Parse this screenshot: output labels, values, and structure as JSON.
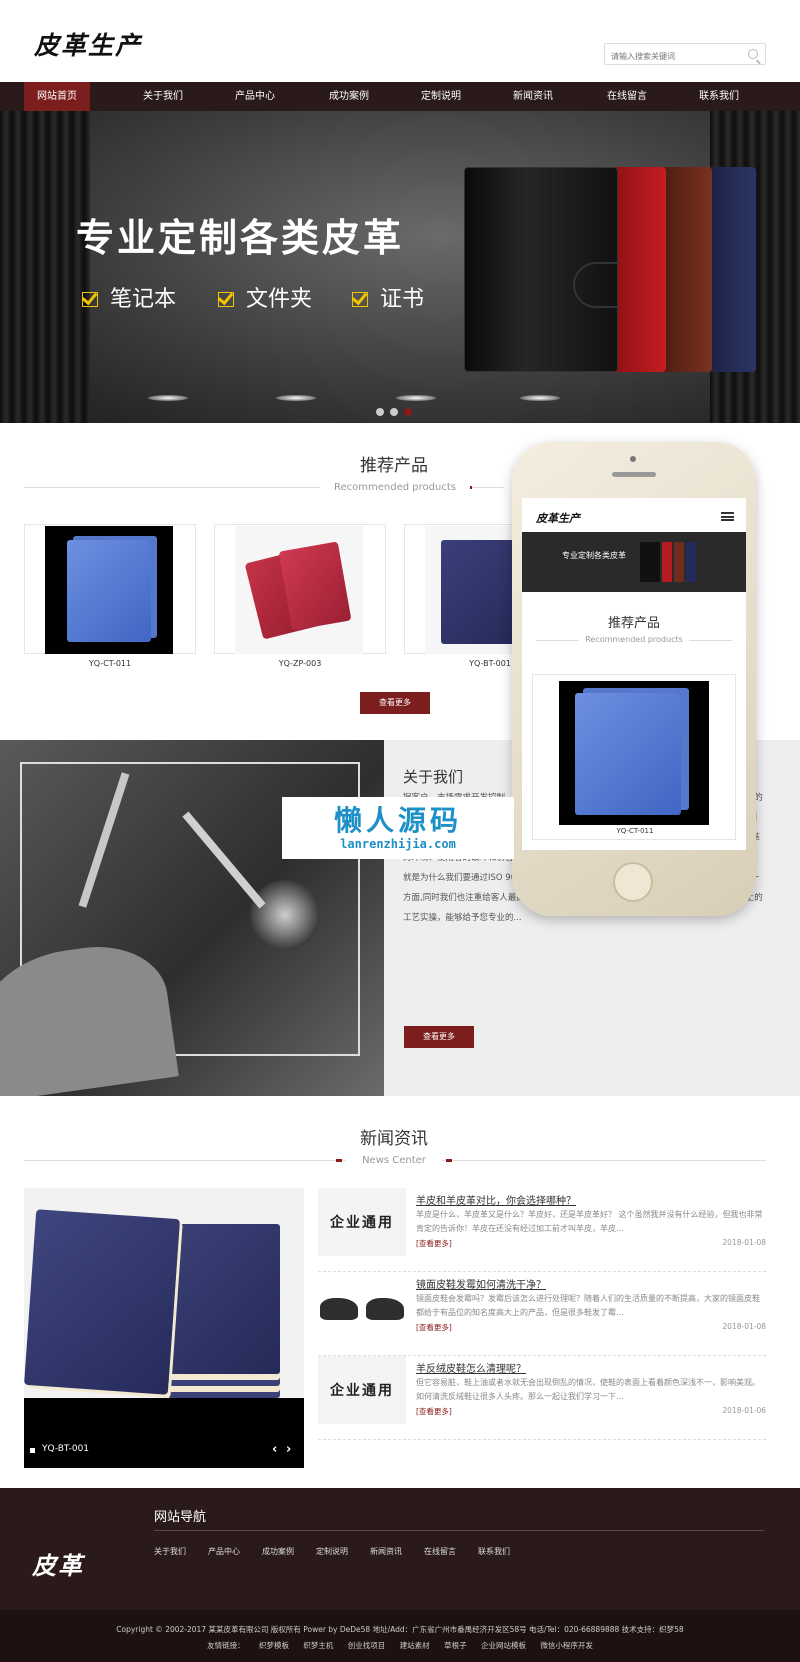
{
  "header": {
    "logo": "皮革生产",
    "search_placeholder": "请输入搜索关键词"
  },
  "nav": {
    "items": [
      "网站首页",
      "关于我们",
      "产品中心",
      "成功案例",
      "定制说明",
      "新闻资讯",
      "在线留言",
      "联系我们"
    ],
    "active_index": 0
  },
  "banner": {
    "title": "专业定制各类皮革",
    "features": [
      "笔记本",
      "文件夹",
      "证书"
    ],
    "slide_count": 3,
    "active_slide": 2
  },
  "products": {
    "title": "推荐产品",
    "subtitle": "Recommended products",
    "items": [
      {
        "label": "YQ-CT-011"
      },
      {
        "label": "YQ-ZP-003"
      },
      {
        "label": "YQ-BT-001"
      }
    ],
    "more_button": "查看更多"
  },
  "about": {
    "title": "关于我们",
    "text": "据客户、市场需求开发控制，能以确保我们的皮革能够满足…标,在过去的几年里我们有很多…的活动对环境所成的影响,和我们坚持严格管理制度，旨在减少任何潜在的破坏环境行为,定期检测和监控。所以我们所生产的产品均可按要求达到欧美最新环保、物性标准，尽最大努力减少皮革对环境、使用者的破坏和伤害。质量与服务 维护质量对我们非常重要,这是我们生存的根本！这就是为什么我们要通过ISO 9001管理标准的原因。然而,我们非常意识到产品质量的只是其中一方面,同时我们也注重给客人最高水平的客户服务。我们的销售团队均在工厂基层做好两年以上的工艺实操，能够给予您专业的...",
    "more_button": "查看更多"
  },
  "phone": {
    "logo": "皮革生产",
    "banner_text": "专业定制各类皮革",
    "section_title": "推荐产品",
    "section_subtitle": "Recommended products",
    "product_label": "YQ-CT-011"
  },
  "watermark": {
    "title": "懒人源码",
    "url": "lanrenzhijia.com"
  },
  "news": {
    "title": "新闻资讯",
    "subtitle": "News Center",
    "featured_caption": "YQ-BT-001",
    "items": [
      {
        "title": "羊皮和羊皮革对比，你会选择哪种？",
        "desc": "羊皮是什么，羊皮革又是什么？羊皮好，还是羊皮革好？ 这个虽然我并没有什么经验，但我也非常肯定的告诉你！羊皮在还没有经过加工前才叫羊皮，羊皮...",
        "more": "[查看更多]",
        "date": "2018-01-08",
        "thumb_text": "企业通用"
      },
      {
        "title": "镜面皮鞋发霉如何清洗干净？",
        "desc": "镜面皮鞋会发霉吗？发霉后该怎么进行处理呢？随着人们的生活质量的不断提高，大家的镜面皮鞋都给于有品位的知名度高大上的产品，但是很多鞋发了霉...",
        "more": "[查看更多]",
        "date": "2018-01-08",
        "thumb_text": ""
      },
      {
        "title": "羊反绒皮鞋怎么清理呢？",
        "desc": "但它容易脏，鞋上油或者水就无会出现倒乱的情况，使鞋的表面上看着颜色深浅不一，影响美观。如何清洗反绒鞋让很多人头疼。那么一起让我们学习一下...",
        "more": "[查看更多]",
        "date": "2018-01-06",
        "thumb_text": "企业通用"
      }
    ]
  },
  "footer": {
    "logo": "皮革",
    "nav_title": "网站导航",
    "nav_items": [
      "关于我们",
      "产品中心",
      "成功案例",
      "定制说明",
      "新闻资讯",
      "在线留言",
      "联系我们"
    ],
    "copyright": "Copyright © 2002-2017 某某皮革有限公司 版权所有 Power by DeDe58 地址/Add：广东省广州市番禺经济开发区58号 电话/Tel：020-66889888 技术支持：织梦58",
    "links_label": "友情链接：",
    "links": [
      "织梦模板",
      "织梦主机",
      "创业找项目",
      "建站素材",
      "草根子",
      "企业网站模板",
      "微信小程序开发"
    ]
  },
  "colors": {
    "accent": "#7d1e1e",
    "nav_bg": "#2b1a1a",
    "footer_bg": "#2b1a1a"
  }
}
